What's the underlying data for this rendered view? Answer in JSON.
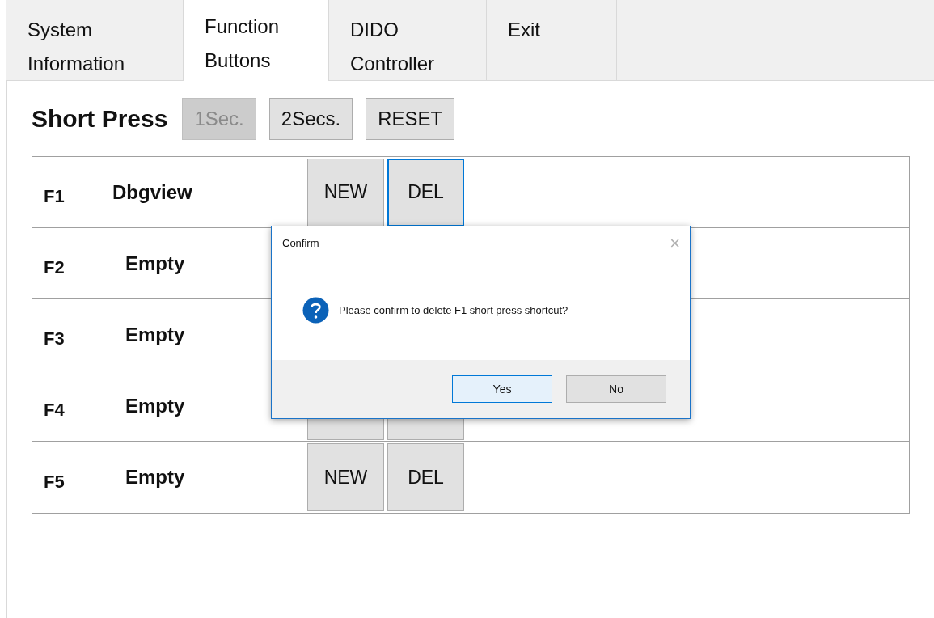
{
  "tabs": [
    {
      "label": "System\nInformation",
      "selected": false
    },
    {
      "label": "Function\nButtons",
      "selected": true
    },
    {
      "label": "DIDO\nController",
      "selected": false
    },
    {
      "label": "Exit",
      "selected": false
    }
  ],
  "heading": "Short Press",
  "duration_buttons": [
    {
      "label": "1Sec.",
      "disabled": true
    },
    {
      "label": "2Secs.",
      "disabled": false
    },
    {
      "label": "RESET",
      "disabled": false
    }
  ],
  "rows": [
    {
      "key": "F1",
      "name": "Dbgview",
      "buttons": [
        {
          "label": "NEW",
          "focused": false
        },
        {
          "label": "DEL",
          "focused": true
        }
      ]
    },
    {
      "key": "F2",
      "name": "Empty"
    },
    {
      "key": "F3",
      "name": "Empty"
    },
    {
      "key": "F4",
      "name": "Empty"
    },
    {
      "key": "F5",
      "name": "Empty",
      "buttons": [
        {
          "label": "NEW",
          "focused": false
        },
        {
          "label": "DEL",
          "focused": false
        }
      ]
    }
  ],
  "dialog": {
    "title": "Confirm",
    "close": "×",
    "message": "Please confirm to delete F1 short press shortcut?",
    "buttons": [
      {
        "label": "Yes",
        "default": true
      },
      {
        "label": "No",
        "default": false
      }
    ]
  }
}
